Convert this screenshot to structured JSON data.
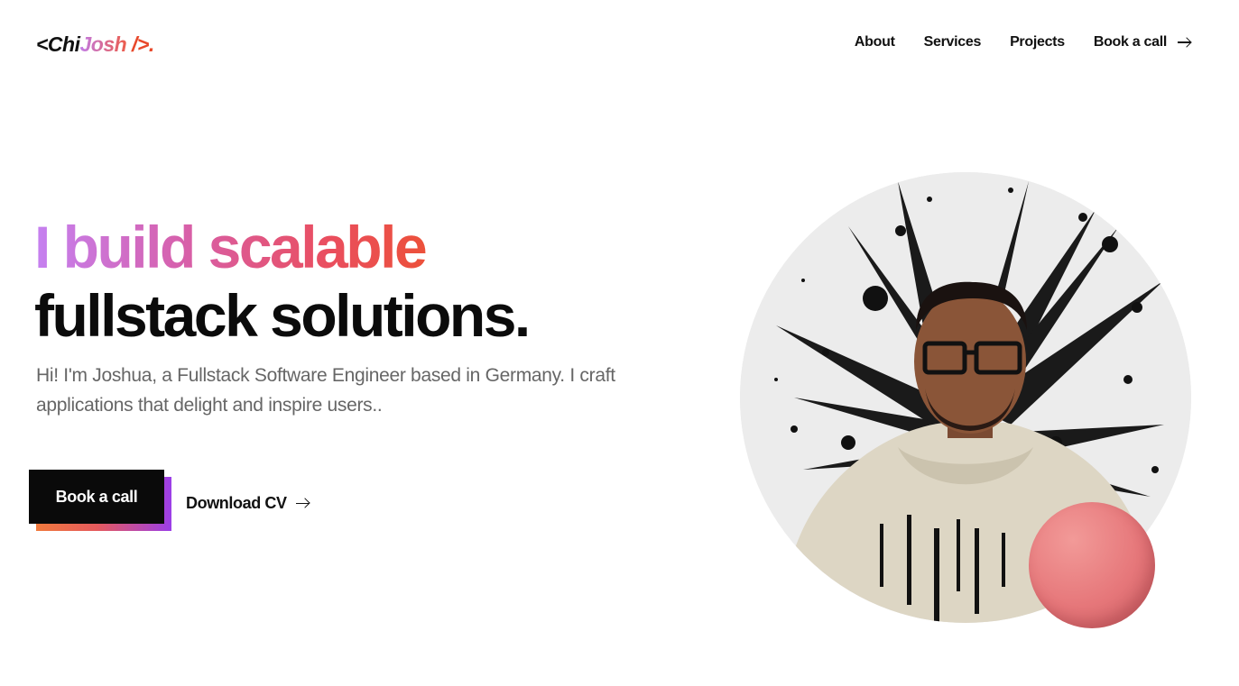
{
  "header": {
    "logo": {
      "part1": "<Chi",
      "part2": "Josh",
      "part3": " />."
    },
    "nav": {
      "about": "About",
      "services": "Services",
      "projects": "Projects",
      "book_call": "Book a call"
    }
  },
  "hero": {
    "headline_line1": "I build scalable",
    "headline_line2": "fullstack solutions.",
    "intro": "Hi! I'm Joshua, a Fullstack Software Engineer based in Germany. I craft applications that delight and inspire users..",
    "primary_button": "Book a call",
    "secondary_link": "Download CV"
  },
  "icons": {
    "nav_arrow": "arrow-right-icon",
    "download_arrow": "arrow-right-icon"
  },
  "colors": {
    "gradient_start": "#c581f1",
    "gradient_mid": "#ea4e5d",
    "gradient_end": "#ee5415",
    "text_dark": "#0b0b0b",
    "text_muted": "#666666",
    "ball": "#e6777a"
  }
}
